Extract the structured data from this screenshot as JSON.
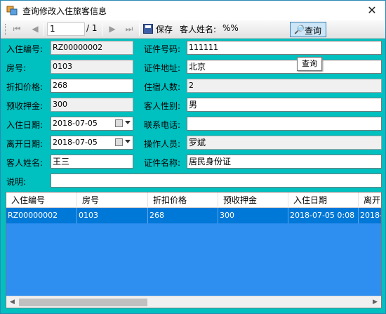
{
  "window": {
    "title": "查询修改入住旅客信息",
    "close_glyph": "✕"
  },
  "toolbar": {
    "position": "1",
    "total": "/ 1",
    "first_glyph": "⏮",
    "prev_glyph": "◀",
    "next_glyph": "▶",
    "last_glyph": "⏭",
    "save_label": "保存",
    "name_label": "客人姓名:",
    "name_value": "%%",
    "query_label": "查询",
    "query_icon": "magnifier-icon"
  },
  "tooltip": "查询",
  "form": {
    "checkin_no_label": "入住编号:",
    "checkin_no": "RZ00000002",
    "id_no_label": "证件号码:",
    "id_no": "111111",
    "room_label": "房号:",
    "room": "0103",
    "id_addr_label": "证件地址:",
    "id_addr": "北京",
    "discount_label": "折扣价格:",
    "discount": "268",
    "guests_label": "住宿人数:",
    "guests": "2",
    "deposit_label": "预收押金:",
    "deposit": "300",
    "gender_label": "客人性别:",
    "gender": "男",
    "checkin_date_label": "入住日期:",
    "checkin_date": "2018-07-05",
    "phone_label": "联系电话:",
    "phone": "",
    "checkout_date_label": "离开日期:",
    "checkout_date": "2018-07-05",
    "operator_label": "操作人员:",
    "operator": "罗斌",
    "guest_name_label": "客人姓名:",
    "guest_name": "王三",
    "id_type_label": "证件名称:",
    "id_type": "居民身份证",
    "note_label": "说明:",
    "note": ""
  },
  "grid": {
    "headers": [
      "入住编号",
      "房号",
      "折扣价格",
      "预收押金",
      "入住日期",
      "离开"
    ],
    "rows": [
      [
        "RZ00000002",
        "0103",
        "268",
        "300",
        "2018-07-05 0:08",
        "2018-"
      ]
    ]
  },
  "colors": {
    "background": "#00c0c0",
    "selection": "#0078d7",
    "grid_bg": "#2f8ff0"
  }
}
